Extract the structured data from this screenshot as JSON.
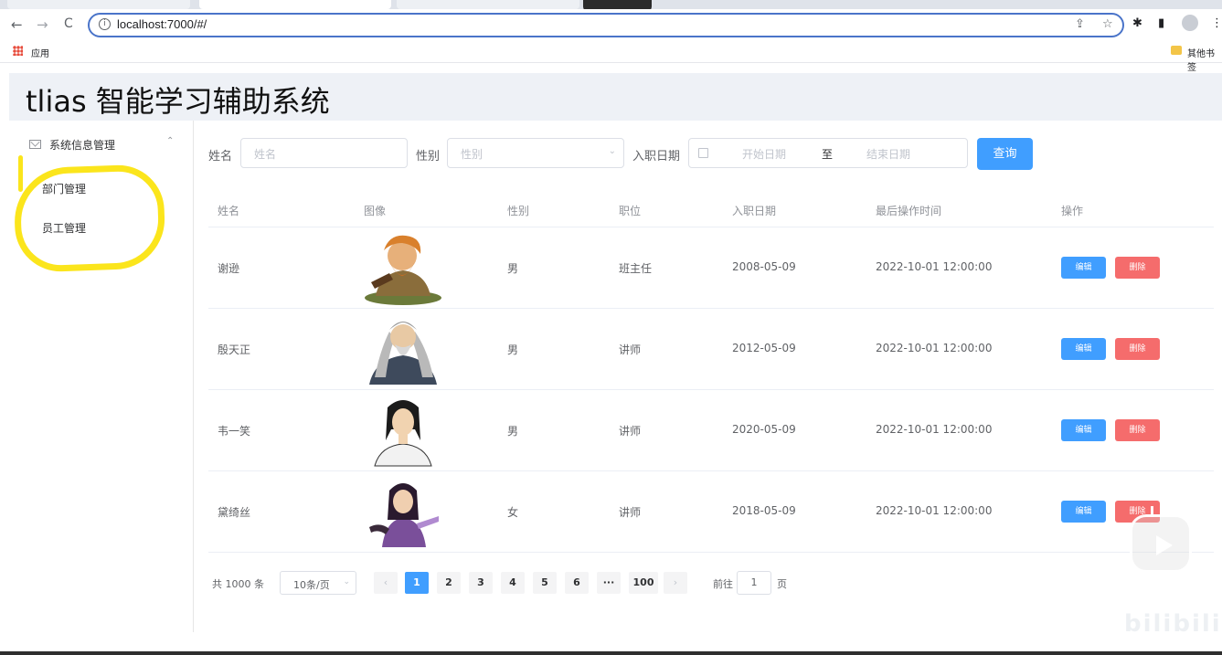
{
  "browser": {
    "url": "localhost:7000/#/",
    "bookmark_apps_label": "应用",
    "bookmark_other_label": "其他书签",
    "back_icon": "←",
    "forward_icon": "→",
    "reload_icon": "C"
  },
  "app": {
    "title": "tlias 智能学习辅助系统"
  },
  "sidebar": {
    "group_label": "系统信息管理",
    "items": [
      {
        "label": "部门管理"
      },
      {
        "label": "员工管理"
      }
    ],
    "highlight_color": "#fbe51c"
  },
  "search": {
    "name_label": "姓名",
    "name_placeholder": "姓名",
    "gender_label": "性别",
    "gender_placeholder": "性别",
    "date_label": "入职日期",
    "start_placeholder": "开始日期",
    "range_separator": "至",
    "end_placeholder": "结束日期",
    "query_button": "查询"
  },
  "table": {
    "headers": [
      "姓名",
      "图像",
      "性别",
      "职位",
      "入职日期",
      "最后操作时间",
      "操作"
    ],
    "rows": [
      {
        "name": "谢逊",
        "gender": "男",
        "position": "班主任",
        "entry_date": "2008-05-09",
        "update_time": "2022-10-01 12:00:00",
        "edit": "编辑",
        "delete": "删除"
      },
      {
        "name": "殷天正",
        "gender": "男",
        "position": "讲师",
        "entry_date": "2012-05-09",
        "update_time": "2022-10-01 12:00:00",
        "edit": "编辑",
        "delete": "删除"
      },
      {
        "name": "韦一笑",
        "gender": "男",
        "position": "讲师",
        "entry_date": "2020-05-09",
        "update_time": "2022-10-01 12:00:00",
        "edit": "编辑",
        "delete": "删除"
      },
      {
        "name": "黛绮丝",
        "gender": "女",
        "position": "讲师",
        "entry_date": "2018-05-09",
        "update_time": "2022-10-01 12:00:00",
        "edit": "编辑",
        "delete": "删除"
      }
    ]
  },
  "pagination": {
    "total_text": "共 1000 条",
    "page_size": "10条/页",
    "prev": "‹",
    "pages": [
      "1",
      "2",
      "3",
      "4",
      "5",
      "6",
      "···",
      "100"
    ],
    "next": "›",
    "current": "1",
    "goto_label": "前往",
    "goto_value": "1",
    "goto_suffix": "页"
  },
  "colors": {
    "primary": "#409eff",
    "danger": "#f56c6c",
    "header_bg": "#eef1f6"
  },
  "overlay": {
    "watermark": "bilibili"
  }
}
